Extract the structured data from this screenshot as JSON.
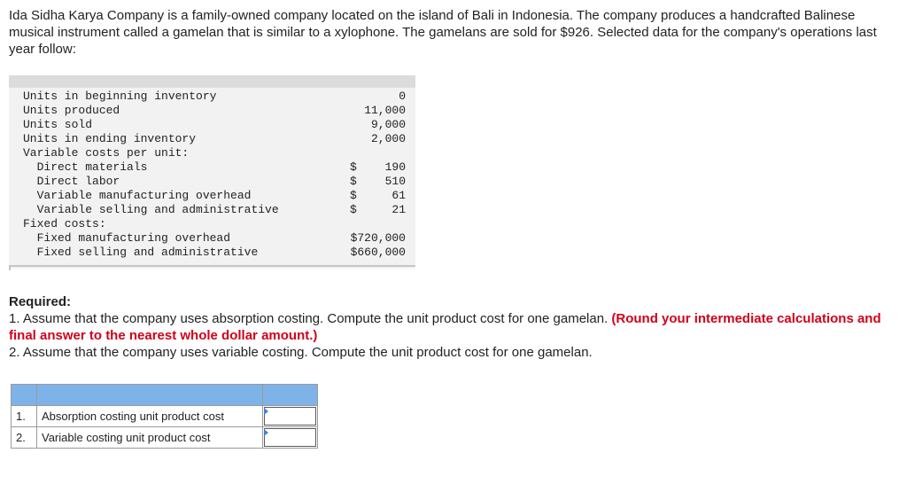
{
  "intro_text": "Ida Sidha Karya Company is a family-owned company located on the island of Bali in Indonesia. The company produces a handcrafted Balinese musical instrument called a gamelan that is similar to a xylophone. The gamelans are sold for $926. Selected data for the company's operations last year follow:",
  "data_rows": [
    {
      "label": "Units in beginning inventory",
      "currency": "",
      "value": "0"
    },
    {
      "label": "Units produced",
      "currency": "",
      "value": "11,000"
    },
    {
      "label": "Units sold",
      "currency": "",
      "value": "9,000"
    },
    {
      "label": "Units in ending inventory",
      "currency": "",
      "value": "2,000"
    },
    {
      "label": "Variable costs per unit:",
      "currency": "",
      "value": ""
    },
    {
      "label": "  Direct materials",
      "currency": "$",
      "value": "190"
    },
    {
      "label": "  Direct labor",
      "currency": "$",
      "value": "510"
    },
    {
      "label": "  Variable manufacturing overhead",
      "currency": "$",
      "value": "61"
    },
    {
      "label": "  Variable selling and administrative",
      "currency": "$",
      "value": "21"
    },
    {
      "label": "Fixed costs:",
      "currency": "",
      "value": ""
    },
    {
      "label": "  Fixed manufacturing overhead",
      "currency": "",
      "value": "$720,000"
    },
    {
      "label": "  Fixed selling and administrative",
      "currency": "",
      "value": "$660,000"
    }
  ],
  "required": {
    "heading": "Required:",
    "item1_text": "1. Assume that the company uses absorption costing. Compute the unit product cost for one gamelan.",
    "item1_note": "(Round your intermediate calculations and final answer to the nearest whole dollar amount.)",
    "item2_text": "2. Assume that the company uses variable costing. Compute the unit product cost for one gamelan."
  },
  "answer_table": {
    "rows": [
      {
        "num": "1.",
        "label": "Absorption costing unit product cost",
        "value": ""
      },
      {
        "num": "2.",
        "label": "Variable costing unit product cost",
        "value": ""
      }
    ]
  }
}
